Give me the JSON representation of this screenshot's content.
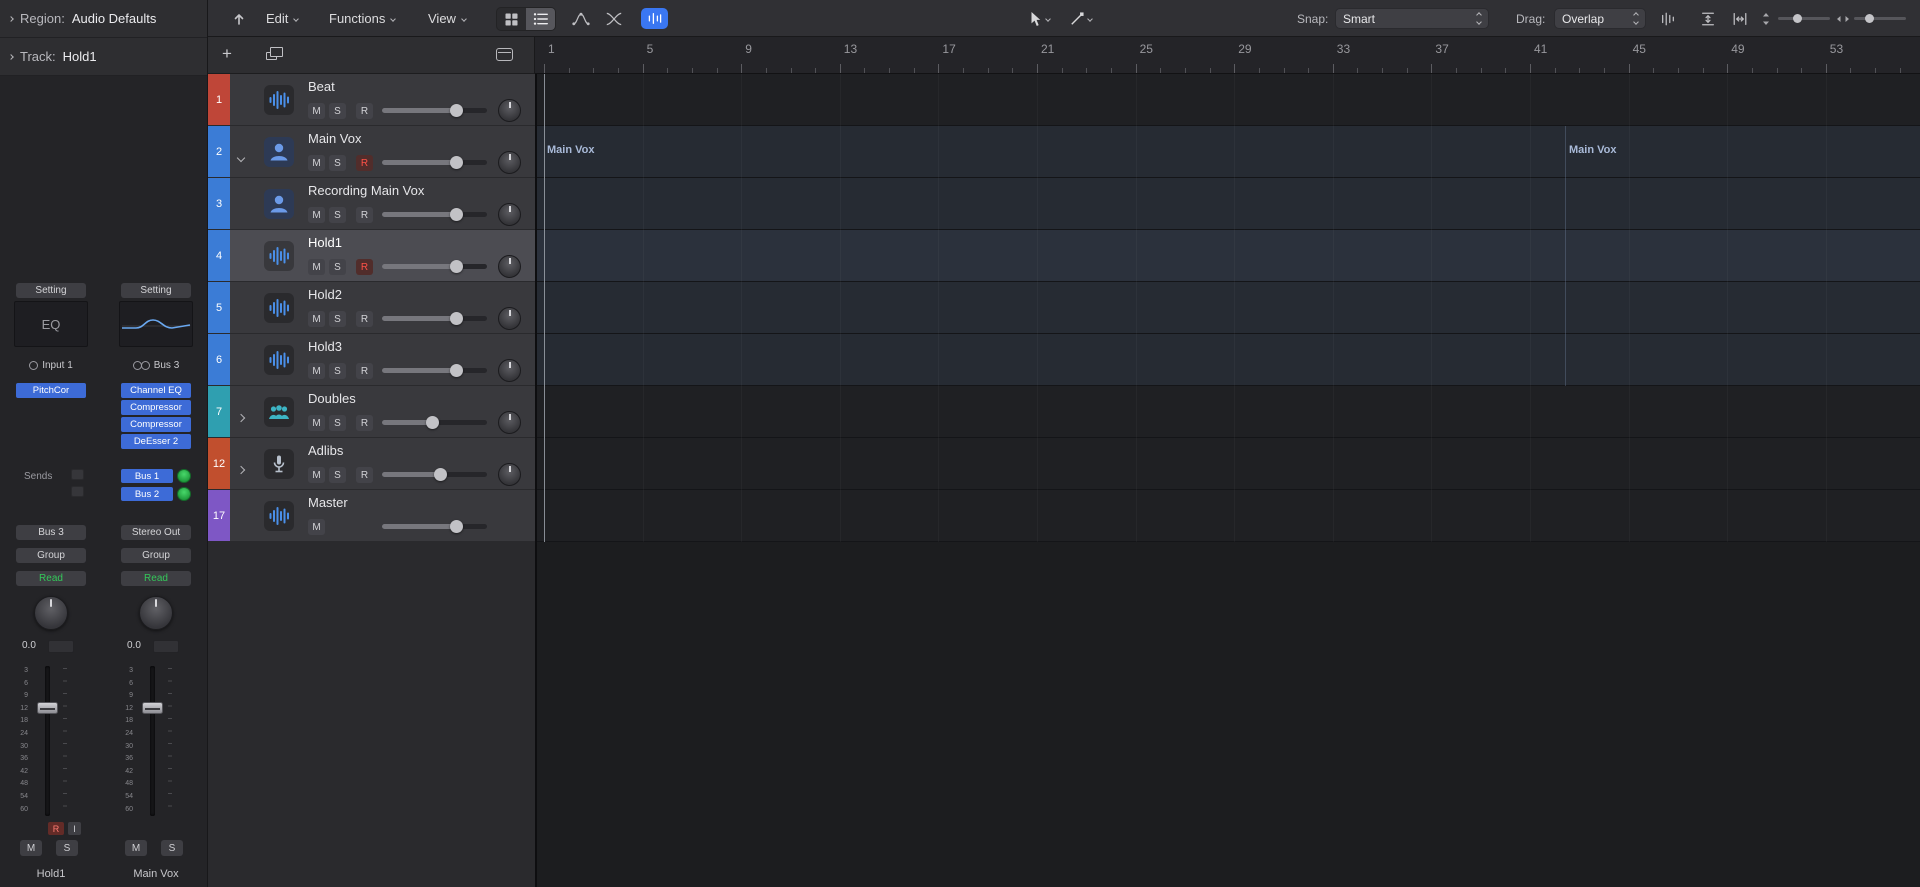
{
  "colors": {
    "accent_blue": "#3a77f2",
    "plugin_blue": "#3d6bd7",
    "record_red": "#ff5148",
    "automation_green": "#34c85a",
    "track_blue": "#3b7cd6"
  },
  "toolbar": {
    "edit_menu": "Edit",
    "functions_menu": "Functions",
    "view_menu": "View",
    "snap_label": "Snap:",
    "snap_value": "Smart",
    "drag_label": "Drag:",
    "drag_value": "Overlap"
  },
  "inspector": {
    "region_row": {
      "label": "Region:",
      "value": "Audio Defaults"
    },
    "track_row": {
      "label": "Track:",
      "value": "Hold1"
    },
    "fader_scale": [
      "3",
      "6",
      "9",
      "12",
      "18",
      "24",
      "30",
      "36",
      "42",
      "48",
      "54",
      "60"
    ],
    "strips": {
      "left": {
        "setting": "Setting",
        "eq_label": "EQ",
        "input": "Input 1",
        "plugins": [
          "PitchCor"
        ],
        "sends_label": "Sends",
        "output": "Bus 3",
        "group": "Group",
        "automation_mode": "Read",
        "pan_value": "0.0",
        "record": "R",
        "input_monitor": "I",
        "mute": "M",
        "solo": "S",
        "name": "Hold1"
      },
      "right": {
        "setting": "Setting",
        "input": "Bus 3",
        "plugins": [
          "Channel EQ",
          "Compressor",
          "Compressor",
          "DeEsser 2"
        ],
        "sends": [
          "Bus 1",
          "Bus 2"
        ],
        "output": "Stereo Out",
        "group": "Group",
        "automation_mode": "Read",
        "pan_value": "0.0",
        "mute": "M",
        "solo": "S",
        "name": "Main Vox"
      }
    }
  },
  "list_header": {
    "plus": "+"
  },
  "track_list": {
    "tracks": [
      {
        "num": "1",
        "name": "Beat",
        "color": "#bf4638",
        "icon": "waveform",
        "mute": "M",
        "solo": "S",
        "record": "R",
        "armed": false,
        "selected": false,
        "slider": 0.7,
        "pan": true
      },
      {
        "num": "2",
        "name": "Main Vox",
        "color": "#3b7cd6",
        "icon": "vocalist",
        "disclosure": "open",
        "mute": "M",
        "solo": "S",
        "record": "R",
        "armed": true,
        "selected": false,
        "slider": 0.7,
        "pan": true
      },
      {
        "num": "3",
        "name": "Recording Main Vox",
        "color": "#3b7cd6",
        "icon": "vocalist",
        "mute": "M",
        "solo": "S",
        "record": "R",
        "armed": false,
        "selected": false,
        "slider": 0.7,
        "pan": true
      },
      {
        "num": "4",
        "name": "Hold1",
        "color": "#3b7cd6",
        "icon": "waveform",
        "mute": "M",
        "solo": "S",
        "record": "R",
        "armed": true,
        "selected": true,
        "slider": 0.7,
        "pan": true
      },
      {
        "num": "5",
        "name": "Hold2",
        "color": "#3b7cd6",
        "icon": "waveform",
        "mute": "M",
        "solo": "S",
        "record": "R",
        "armed": false,
        "selected": false,
        "slider": 0.7,
        "pan": true
      },
      {
        "num": "6",
        "name": "Hold3",
        "color": "#3b7cd6",
        "icon": "waveform",
        "mute": "M",
        "solo": "S",
        "record": "R",
        "armed": false,
        "selected": false,
        "slider": 0.7,
        "pan": true
      },
      {
        "num": "7",
        "name": "Doubles",
        "color": "#2f9fb0",
        "icon": "group",
        "disclosure": "closed",
        "mute": "M",
        "solo": "S",
        "record": "R",
        "armed": false,
        "selected": false,
        "slider": 0.48,
        "pan": true
      },
      {
        "num": "12",
        "name": "Adlibs",
        "color": "#c14f2e",
        "icon": "mic",
        "disclosure": "closed",
        "mute": "M",
        "solo": "S",
        "record": "R",
        "armed": false,
        "selected": false,
        "slider": 0.55,
        "pan": true
      },
      {
        "num": "17",
        "name": "Master",
        "color": "#7e57c5",
        "icon": "waveform",
        "mute": "M",
        "armed": false,
        "selected": false,
        "slider": 0.7,
        "pan": false
      }
    ]
  },
  "ruler": {
    "marks": [
      "1",
      "5",
      "9",
      "13",
      "17",
      "21",
      "25",
      "29",
      "33",
      "37",
      "41",
      "45",
      "49",
      "53"
    ]
  },
  "arrange": {
    "regions": [
      {
        "name": "Main Vox"
      },
      {
        "name": "Main Vox"
      }
    ]
  },
  "icons": {
    "back": "arrow-up",
    "grid": "grid-squares",
    "list": "rows",
    "automation": "curve-with-nodes",
    "flex": "crossed-curves",
    "flex-mode": "bars",
    "pointer-tool": "cursor-arrow",
    "pencil-tool": "diagonal-line",
    "plus": "+",
    "duplicate": "overlapping-squares",
    "track-config": "panel",
    "disclosure-open": "chevron-down",
    "disclosure-closed": "chevron-right",
    "vertical-zoom": "up-down-arrows",
    "horizontal-zoom": "left-right-arrows"
  }
}
